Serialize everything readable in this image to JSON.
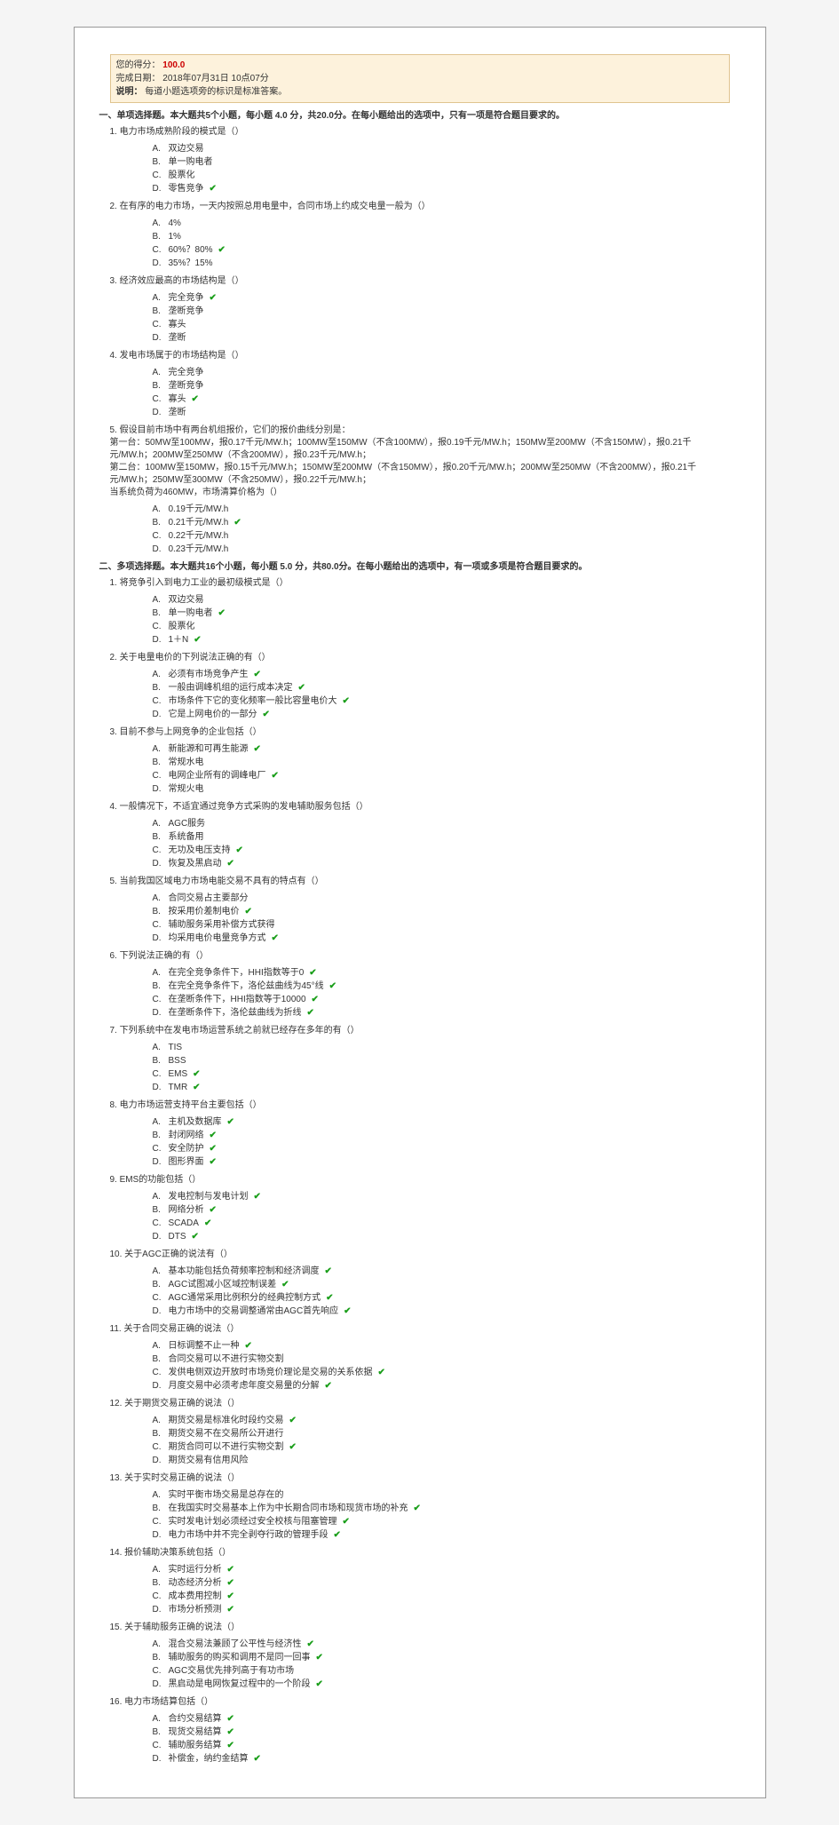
{
  "header": {
    "score_label": "您的得分：",
    "score_value": "100.0",
    "date_label": "完成日期：",
    "date_value": "2018年07月31日 10点07分",
    "note_label": "说明：",
    "note_value": "每道小题选项旁的标识是标准答案。"
  },
  "section1": {
    "title": "一、单项选择题。本大题共5个小题，每小题 4.0 分，共20.0分。在每小题给出的选项中，只有一项是符合题目要求的。",
    "q1": {
      "text": "1. 电力市场成熟阶段的模式是（）",
      "opts": [
        {
          "k": "A.",
          "t": "双边交易",
          "c": false
        },
        {
          "k": "B.",
          "t": "单一购电者",
          "c": false
        },
        {
          "k": "C.",
          "t": "股票化",
          "c": false
        },
        {
          "k": "D.",
          "t": "零售竞争",
          "c": true
        }
      ]
    },
    "q2": {
      "text": "2. 在有序的电力市场，一天内按照总用电量中，合同市场上约成交电量一般为（）",
      "opts": [
        {
          "k": "A.",
          "t": "4%",
          "c": false
        },
        {
          "k": "B.",
          "t": "1%",
          "c": false
        },
        {
          "k": "C.",
          "t": "60%？80%",
          "c": true
        },
        {
          "k": "D.",
          "t": "35%？15%",
          "c": false
        }
      ]
    },
    "q3": {
      "text": "3. 经济效应最高的市场结构是（）",
      "opts": [
        {
          "k": "A.",
          "t": "完全竞争",
          "c": true
        },
        {
          "k": "B.",
          "t": "垄断竞争",
          "c": false
        },
        {
          "k": "C.",
          "t": "寡头",
          "c": false
        },
        {
          "k": "D.",
          "t": "垄断",
          "c": false
        }
      ]
    },
    "q4": {
      "text": "4. 发电市场属于的市场结构是（）",
      "opts": [
        {
          "k": "A.",
          "t": "完全竞争",
          "c": false
        },
        {
          "k": "B.",
          "t": "垄断竞争",
          "c": false
        },
        {
          "k": "C.",
          "t": "寡头",
          "c": true
        },
        {
          "k": "D.",
          "t": "垄断",
          "c": false
        }
      ]
    },
    "q5": {
      "head": "5. 假设目前市场中有两台机组报价，它们的报价曲线分别是：",
      "l1": "第一台：50MW至100MW，报0.17千元/MW.h；100MW至150MW（不含100MW），报0.19千元/MW.h；150MW至200MW（不含150MW），报0.21千元/MW.h；200MW至250MW（不含200MW），报0.23千元/MW.h；",
      "l2": "第二台：100MW至150MW，报0.15千元/MW.h；150MW至200MW（不含150MW），报0.20千元/MW.h；200MW至250MW（不含200MW），报0.21千元/MW.h；250MW至300MW（不含250MW），报0.22千元/MW.h；",
      "l3": "当系统负荷为460MW，市场清算价格为（）",
      "opts": [
        {
          "k": "A.",
          "t": "0.19千元/MW.h",
          "c": false
        },
        {
          "k": "B.",
          "t": "0.21千元/MW.h",
          "c": true
        },
        {
          "k": "C.",
          "t": "0.22千元/MW.h",
          "c": false
        },
        {
          "k": "D.",
          "t": "0.23千元/MW.h",
          "c": false
        }
      ]
    }
  },
  "section2": {
    "title": "二、多项选择题。本大题共16个小题，每小题 5.0 分，共80.0分。在每小题给出的选项中，有一项或多项是符合题目要求的。",
    "q1": {
      "text": "1. 将竞争引入到电力工业的最初级模式是（）",
      "opts": [
        {
          "k": "A.",
          "t": "双边交易",
          "c": false
        },
        {
          "k": "B.",
          "t": "单一购电者",
          "c": true
        },
        {
          "k": "C.",
          "t": "股票化",
          "c": false
        },
        {
          "k": "D.",
          "t": "1＋N",
          "c": true
        }
      ]
    },
    "q2": {
      "text": "2. 关于电量电价的下列说法正确的有（）",
      "opts": [
        {
          "k": "A.",
          "t": "必须有市场竞争产生",
          "c": true
        },
        {
          "k": "B.",
          "t": "一般由调峰机组的运行成本决定",
          "c": true
        },
        {
          "k": "C.",
          "t": "市场条件下它的变化频率一般比容量电价大",
          "c": true
        },
        {
          "k": "D.",
          "t": "它是上网电价的一部分",
          "c": true
        }
      ]
    },
    "q3": {
      "text": "3. 目前不参与上网竞争的企业包括（）",
      "opts": [
        {
          "k": "A.",
          "t": "新能源和可再生能源",
          "c": true
        },
        {
          "k": "B.",
          "t": "常规水电",
          "c": false
        },
        {
          "k": "C.",
          "t": "电网企业所有的调峰电厂",
          "c": true
        },
        {
          "k": "D.",
          "t": "常规火电",
          "c": false
        }
      ]
    },
    "q4": {
      "text": "4. 一般情况下，不适宜通过竞争方式采购的发电辅助服务包括（）",
      "opts": [
        {
          "k": "A.",
          "t": "AGC服务",
          "c": false
        },
        {
          "k": "B.",
          "t": "系统备用",
          "c": false
        },
        {
          "k": "C.",
          "t": "无功及电压支持",
          "c": true
        },
        {
          "k": "D.",
          "t": "恢复及黑启动",
          "c": true
        }
      ]
    },
    "q5": {
      "text": "5. 当前我国区域电力市场电能交易不具有的特点有（）",
      "opts": [
        {
          "k": "A.",
          "t": "合同交易占主要部分",
          "c": false
        },
        {
          "k": "B.",
          "t": "按采用价差制电价",
          "c": true
        },
        {
          "k": "C.",
          "t": "辅助服务采用补偿方式获得",
          "c": false
        },
        {
          "k": "D.",
          "t": "均采用电价电量竞争方式",
          "c": true
        }
      ]
    },
    "q6": {
      "text": "6. 下列说法正确的有（）",
      "opts": [
        {
          "k": "A.",
          "t": "在完全竞争条件下，HHI指数等于0",
          "c": true
        },
        {
          "k": "B.",
          "t": "在完全竞争条件下，洛伦兹曲线为45°线",
          "c": true
        },
        {
          "k": "C.",
          "t": "在垄断条件下，HHI指数等于10000",
          "c": true
        },
        {
          "k": "D.",
          "t": "在垄断条件下，洛伦兹曲线为折线",
          "c": true
        }
      ]
    },
    "q7": {
      "text": "7. 下列系统中在发电市场运营系统之前就已经存在多年的有（）",
      "opts": [
        {
          "k": "A.",
          "t": "TIS",
          "c": false
        },
        {
          "k": "B.",
          "t": "BSS",
          "c": false
        },
        {
          "k": "C.",
          "t": "EMS",
          "c": true
        },
        {
          "k": "D.",
          "t": "TMR",
          "c": true
        }
      ]
    },
    "q8": {
      "text": "8. 电力市场运营支持平台主要包括（）",
      "opts": [
        {
          "k": "A.",
          "t": "主机及数据库",
          "c": true
        },
        {
          "k": "B.",
          "t": "封闭网络",
          "c": true
        },
        {
          "k": "C.",
          "t": "安全防护",
          "c": true
        },
        {
          "k": "D.",
          "t": "图形界面",
          "c": true
        }
      ]
    },
    "q9": {
      "text": "9. EMS的功能包括（）",
      "opts": [
        {
          "k": "A.",
          "t": "发电控制与发电计划",
          "c": true
        },
        {
          "k": "B.",
          "t": "网络分析",
          "c": true
        },
        {
          "k": "C.",
          "t": "SCADA",
          "c": true
        },
        {
          "k": "D.",
          "t": "DTS",
          "c": true
        }
      ]
    },
    "q10": {
      "text": "10. 关于AGC正确的说法有（）",
      "opts": [
        {
          "k": "A.",
          "t": "基本功能包括负荷频率控制和经济调度",
          "c": true
        },
        {
          "k": "B.",
          "t": "AGC试图减小区域控制误差",
          "c": true
        },
        {
          "k": "C.",
          "t": "AGC通常采用比例积分的经典控制方式",
          "c": true
        },
        {
          "k": "D.",
          "t": "电力市场中的交易调整通常由AGC首先响应",
          "c": true
        }
      ]
    },
    "q11": {
      "text": "11. 关于合同交易正确的说法（）",
      "opts": [
        {
          "k": "A.",
          "t": "日标调整不止一种",
          "c": true
        },
        {
          "k": "B.",
          "t": "合同交易可以不进行实物交割",
          "c": false
        },
        {
          "k": "C.",
          "t": "发供电侧双边开放时市场竞价理论是交易的关系依据",
          "c": true
        },
        {
          "k": "D.",
          "t": "月度交易中必须考虑年度交易量的分解",
          "c": true
        }
      ]
    },
    "q12": {
      "text": "12. 关于期货交易正确的说法（）",
      "opts": [
        {
          "k": "A.",
          "t": "期货交易是标准化时段约交易",
          "c": true
        },
        {
          "k": "B.",
          "t": "期货交易不在交易所公开进行",
          "c": false
        },
        {
          "k": "C.",
          "t": "期货合同可以不进行实物交割",
          "c": true
        },
        {
          "k": "D.",
          "t": "期货交易有信用风险",
          "c": false
        }
      ]
    },
    "q13": {
      "text": "13. 关于实时交易正确的说法（）",
      "opts": [
        {
          "k": "A.",
          "t": "实时平衡市场交易是总存在的",
          "c": false
        },
        {
          "k": "B.",
          "t": "在我国实时交易基本上作为中长期合同市场和现货市场的补充",
          "c": true
        },
        {
          "k": "C.",
          "t": "实时发电计划必须经过安全校核与阻塞管理",
          "c": true
        },
        {
          "k": "D.",
          "t": "电力市场中并不完全剥夺行政的管理手段",
          "c": true
        }
      ]
    },
    "q14": {
      "text": "14. 报价辅助决策系统包括（）",
      "opts": [
        {
          "k": "A.",
          "t": "实时运行分析",
          "c": true
        },
        {
          "k": "B.",
          "t": "动态经济分析",
          "c": true
        },
        {
          "k": "C.",
          "t": "成本费用控制",
          "c": true
        },
        {
          "k": "D.",
          "t": "市场分析预测",
          "c": true
        }
      ]
    },
    "q15": {
      "text": "15. 关于辅助服务正确的说法（）",
      "opts": [
        {
          "k": "A.",
          "t": "混合交易法兼顾了公平性与经济性",
          "c": true
        },
        {
          "k": "B.",
          "t": "辅助服务的购买和调用不是同一回事",
          "c": true
        },
        {
          "k": "C.",
          "t": "AGC交易优先排列高于有功市场",
          "c": false
        },
        {
          "k": "D.",
          "t": "黑启动是电网恢复过程中的一个阶段",
          "c": true
        }
      ]
    },
    "q16": {
      "text": "16. 电力市场结算包括（）",
      "opts": [
        {
          "k": "A.",
          "t": "合约交易结算",
          "c": true
        },
        {
          "k": "B.",
          "t": "现货交易结算",
          "c": true
        },
        {
          "k": "C.",
          "t": "辅助服务结算",
          "c": true
        },
        {
          "k": "D.",
          "t": "补偿金，纳约金结算",
          "c": true
        }
      ]
    }
  }
}
